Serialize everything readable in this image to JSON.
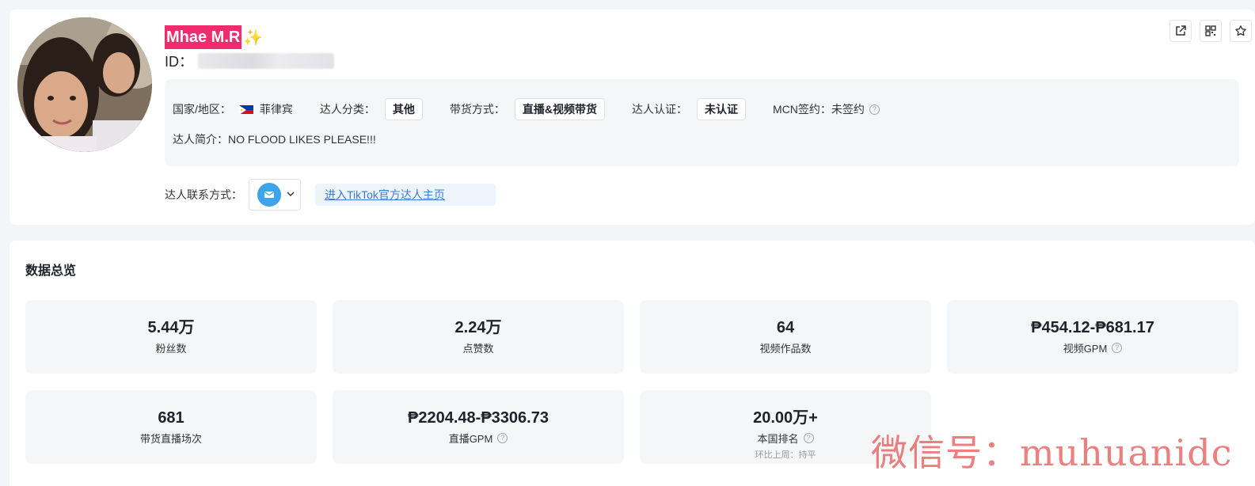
{
  "profile": {
    "name": "Mhae M.R",
    "name_emoji": "✨",
    "id_label": "ID：",
    "country_label": "国家/地区：",
    "country_value": "菲律宾",
    "category_label": "达人分类：",
    "category_value": "其他",
    "sales_label": "带货方式：",
    "sales_value": "直播&视频带货",
    "verify_label": "达人认证：",
    "verify_value": "未认证",
    "mcn_label": "MCN签约：",
    "mcn_value": "未签约",
    "bio_label": "达人简介：",
    "bio_value": "NO FLOOD LIKES PLEASE!!!",
    "contact_label": "达人联系方式：",
    "tiktok_link": "进入TikTok官方达人主页"
  },
  "actions": {
    "icons": [
      "external-link-icon",
      "qrcode-icon",
      "star-icon"
    ]
  },
  "overview": {
    "title": "数据总览",
    "stats": [
      {
        "value": "5.44万",
        "label": "粉丝数"
      },
      {
        "value": "2.24万",
        "label": "点赞数"
      },
      {
        "value": "64",
        "label": "视频作品数"
      },
      {
        "value": "₱454.12-₱681.17",
        "label": "视频GPM"
      },
      {
        "value": "681",
        "label": "带货直播场次"
      },
      {
        "value": "₱2204.48-₱3306.73",
        "label": "直播GPM"
      },
      {
        "value": "20.00万+",
        "label": "本国排名",
        "sub": "环比上周：持平"
      }
    ]
  },
  "watermark": "微信号：muhuanidc",
  "colors": {
    "name_bg": "#ee2c6e",
    "link": "#3a7bd5",
    "mail": "#3ea4ea"
  }
}
